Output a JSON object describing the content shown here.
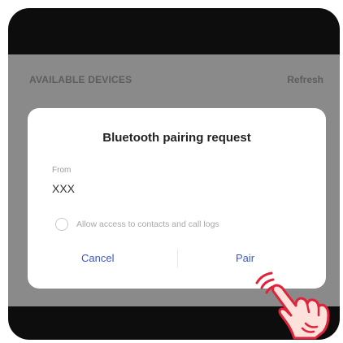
{
  "list": {
    "section_header": "AVAILABLE DEVICES",
    "refresh_label": "Refresh"
  },
  "dialog": {
    "title": "Bluetooth pairing request",
    "from_label": "From",
    "from_value": "XXX",
    "checkbox_label": "Allow access to contacts and call logs",
    "checkbox_checked": false,
    "cancel_label": "Cancel",
    "pair_label": "Pair"
  },
  "icons": {
    "pointer": "tap-hand-icon"
  },
  "colors": {
    "accent": "#3b57c9",
    "overlay": "#8a8a8a",
    "hand_fill": "#fde2dc",
    "hand_stroke": "#e0233a"
  }
}
